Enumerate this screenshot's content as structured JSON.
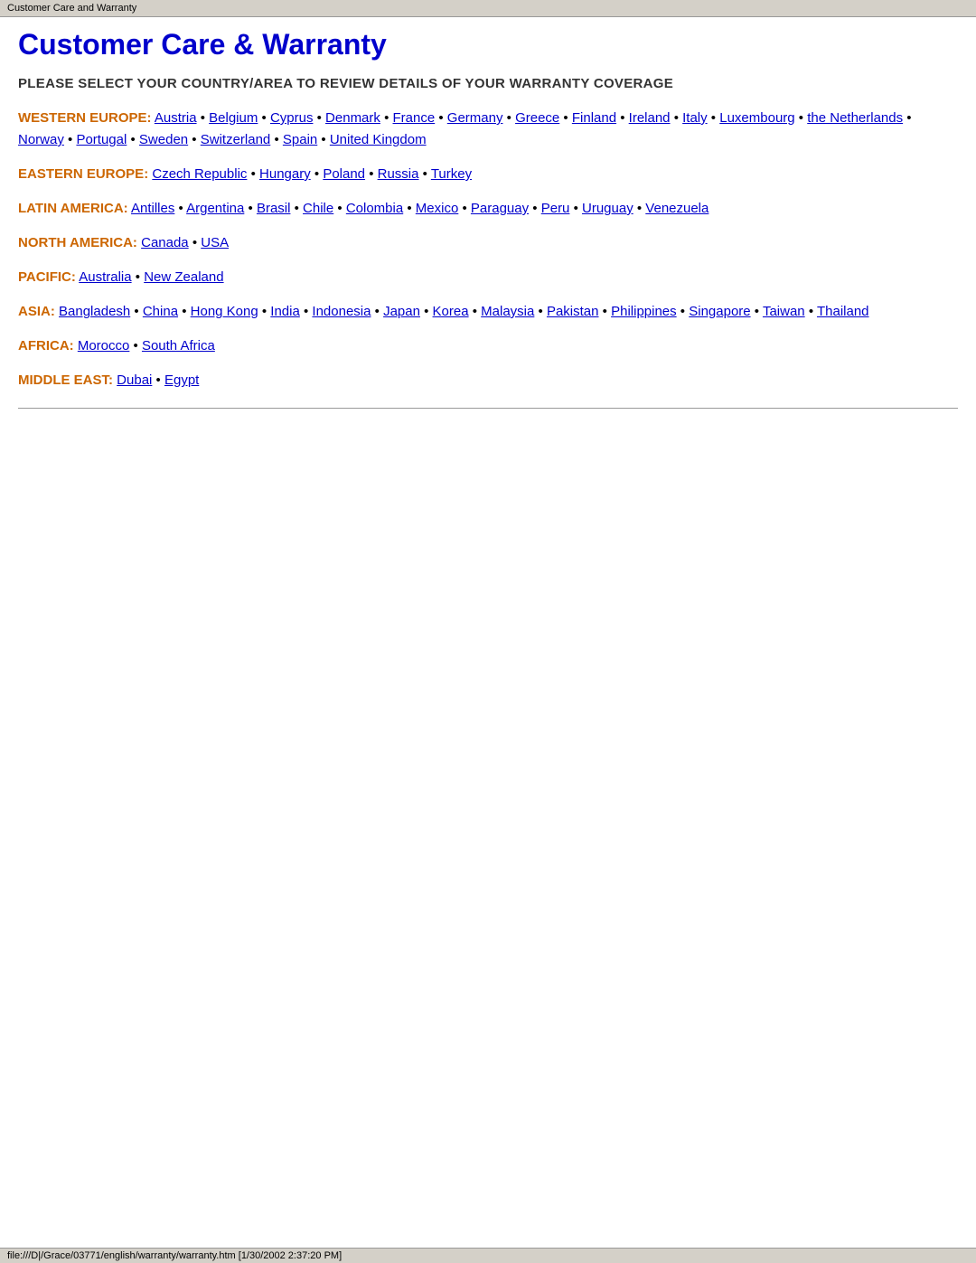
{
  "tab": {
    "title": "Customer Care and Warranty"
  },
  "page": {
    "title": "Customer Care & Warranty",
    "subtitle": "PLEASE SELECT YOUR COUNTRY/AREA TO REVIEW DETAILS OF YOUR WARRANTY COVERAGE"
  },
  "regions": [
    {
      "label": "WESTERN EUROPE:",
      "countries": [
        {
          "name": "Austria",
          "href": "#"
        },
        {
          "name": "Belgium",
          "href": "#"
        },
        {
          "name": "Cyprus",
          "href": "#"
        },
        {
          "name": "Denmark",
          "href": "#"
        },
        {
          "name": "France",
          "href": "#"
        },
        {
          "name": "Germany",
          "href": "#"
        },
        {
          "name": "Greece",
          "href": "#"
        },
        {
          "name": "Finland",
          "href": "#"
        },
        {
          "name": "Ireland",
          "href": "#"
        },
        {
          "name": "Italy",
          "href": "#"
        },
        {
          "name": "Luxembourg",
          "href": "#"
        },
        {
          "name": "the Netherlands",
          "href": "#"
        },
        {
          "name": "Norway",
          "href": "#"
        },
        {
          "name": "Portugal",
          "href": "#"
        },
        {
          "name": "Sweden",
          "href": "#"
        },
        {
          "name": "Switzerland",
          "href": "#"
        },
        {
          "name": "Spain",
          "href": "#"
        },
        {
          "name": "United Kingdom",
          "href": "#"
        }
      ],
      "layout": "wrap"
    },
    {
      "label": "EASTERN EUROPE:",
      "countries": [
        {
          "name": "Czech Republic",
          "href": "#"
        },
        {
          "name": "Hungary",
          "href": "#"
        },
        {
          "name": "Poland",
          "href": "#"
        },
        {
          "name": "Russia",
          "href": "#"
        },
        {
          "name": "Turkey",
          "href": "#"
        }
      ],
      "layout": "inline"
    },
    {
      "label": "LATIN AMERICA:",
      "countries": [
        {
          "name": "Antilles",
          "href": "#"
        },
        {
          "name": "Argentina",
          "href": "#"
        },
        {
          "name": "Brasil",
          "href": "#"
        },
        {
          "name": "Chile",
          "href": "#"
        },
        {
          "name": "Colombia",
          "href": "#"
        },
        {
          "name": "Mexico",
          "href": "#"
        },
        {
          "name": "Paraguay",
          "href": "#"
        },
        {
          "name": "Peru",
          "href": "#"
        },
        {
          "name": "Uruguay",
          "href": "#"
        },
        {
          "name": "Venezuela",
          "href": "#"
        }
      ],
      "layout": "wrap"
    },
    {
      "label": "NORTH AMERICA:",
      "countries": [
        {
          "name": "Canada",
          "href": "#"
        },
        {
          "name": "USA",
          "href": "#"
        }
      ],
      "layout": "inline"
    },
    {
      "label": "PACIFIC:",
      "countries": [
        {
          "name": "Australia",
          "href": "#"
        },
        {
          "name": "New Zealand",
          "href": "#"
        }
      ],
      "layout": "inline"
    },
    {
      "label": "ASIA:",
      "countries": [
        {
          "name": "Bangladesh",
          "href": "#"
        },
        {
          "name": "China",
          "href": "#"
        },
        {
          "name": "Hong Kong",
          "href": "#"
        },
        {
          "name": "India",
          "href": "#"
        },
        {
          "name": "Indonesia",
          "href": "#"
        },
        {
          "name": "Japan",
          "href": "#"
        },
        {
          "name": "Korea",
          "href": "#"
        },
        {
          "name": "Malaysia",
          "href": "#"
        },
        {
          "name": "Pakistan",
          "href": "#"
        },
        {
          "name": "Philippines",
          "href": "#"
        },
        {
          "name": "Singapore",
          "href": "#"
        },
        {
          "name": "Taiwan",
          "href": "#"
        },
        {
          "name": "Thailand",
          "href": "#"
        }
      ],
      "layout": "wrap"
    },
    {
      "label": "AFRICA:",
      "countries": [
        {
          "name": "Morocco",
          "href": "#"
        },
        {
          "name": "South Africa",
          "href": "#"
        }
      ],
      "layout": "inline"
    },
    {
      "label": "MIDDLE EAST:",
      "countries": [
        {
          "name": "Dubai",
          "href": "#"
        },
        {
          "name": "Egypt",
          "href": "#"
        }
      ],
      "layout": "inline"
    }
  ],
  "status_bar": {
    "text": "file:///D|/Grace/03771/english/warranty/warranty.htm [1/30/2002 2:37:20 PM]"
  },
  "colors": {
    "accent": "#cc6600",
    "link": "#0000cc",
    "title": "#0000cc"
  }
}
